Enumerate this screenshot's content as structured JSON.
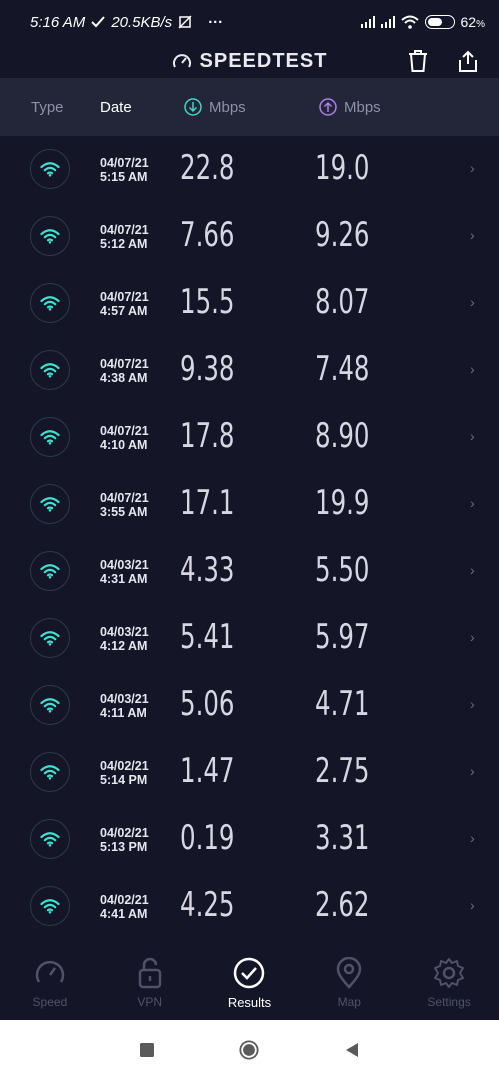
{
  "status": {
    "time": "5:16 AM",
    "speed": "20.5KB/s",
    "dots": "···",
    "battery": "62"
  },
  "header": {
    "title": "SPEEDTEST"
  },
  "columns": {
    "type": "Type",
    "date": "Date",
    "download": "Mbps",
    "upload": "Mbps"
  },
  "results": [
    {
      "date": "04/07/21",
      "time": "5:15 AM",
      "download": "22.8",
      "upload": "19.0"
    },
    {
      "date": "04/07/21",
      "time": "5:12 AM",
      "download": "7.66",
      "upload": "9.26"
    },
    {
      "date": "04/07/21",
      "time": "4:57 AM",
      "download": "15.5",
      "upload": "8.07"
    },
    {
      "date": "04/07/21",
      "time": "4:38 AM",
      "download": "9.38",
      "upload": "7.48"
    },
    {
      "date": "04/07/21",
      "time": "4:10 AM",
      "download": "17.8",
      "upload": "8.90"
    },
    {
      "date": "04/07/21",
      "time": "3:55 AM",
      "download": "17.1",
      "upload": "19.9"
    },
    {
      "date": "04/03/21",
      "time": "4:31 AM",
      "download": "4.33",
      "upload": "5.50"
    },
    {
      "date": "04/03/21",
      "time": "4:12 AM",
      "download": "5.41",
      "upload": "5.97"
    },
    {
      "date": "04/03/21",
      "time": "4:11 AM",
      "download": "5.06",
      "upload": "4.71"
    },
    {
      "date": "04/02/21",
      "time": "5:14 PM",
      "download": "1.47",
      "upload": "2.75"
    },
    {
      "date": "04/02/21",
      "time": "5:13 PM",
      "download": "0.19",
      "upload": "3.31"
    },
    {
      "date": "04/02/21",
      "time": "4:41 AM",
      "download": "4.25",
      "upload": "2.62"
    }
  ],
  "tabs": [
    {
      "label": "Speed",
      "icon": "gauge-icon",
      "active": false
    },
    {
      "label": "VPN",
      "icon": "lock-icon",
      "active": false
    },
    {
      "label": "Results",
      "icon": "check-circle-icon",
      "active": true
    },
    {
      "label": "Map",
      "icon": "map-pin-icon",
      "active": false
    },
    {
      "label": "Settings",
      "icon": "gear-icon",
      "active": false
    }
  ],
  "colors": {
    "background": "#141526",
    "header_band": "#232638",
    "download_accent": "#3fd6c4",
    "upload_accent": "#b07ee8",
    "wifi_icon": "#3fe0cf"
  }
}
